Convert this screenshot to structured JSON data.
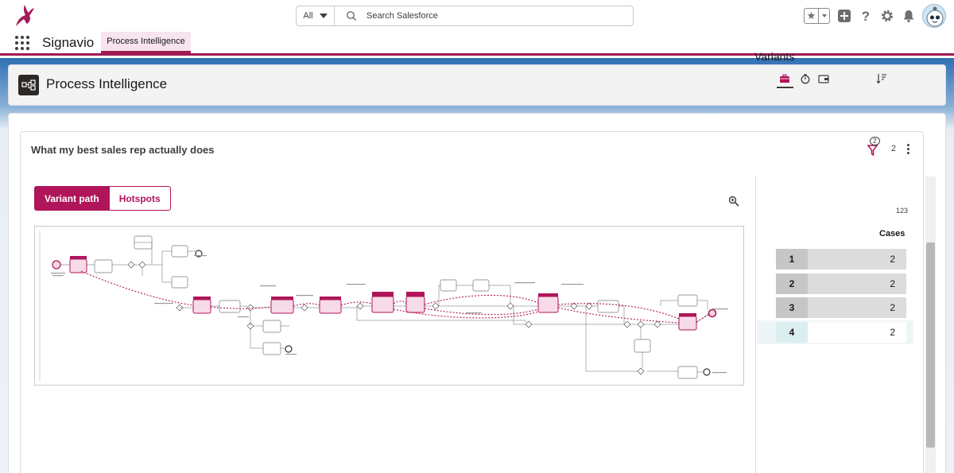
{
  "header": {
    "search": {
      "scope": "All",
      "placeholder": "Search Salesforce"
    },
    "icons": [
      "gazelle-logo-icon",
      "star-icon",
      "plus-icon",
      "help-icon",
      "gear-icon",
      "bell-icon",
      "avatar"
    ]
  },
  "nav": {
    "app_name": "Signavio",
    "tab": "Process Intelligence"
  },
  "page": {
    "title": "Process Intelligence"
  },
  "card": {
    "title": "What my best sales rep actually does",
    "filter_count": "2",
    "filter_number": "2",
    "tabs": {
      "variant_path": "Variant path",
      "hotspots": "Hotspots"
    }
  },
  "variants": {
    "title": "Variants",
    "number_label": "123",
    "cases_label": "Cases",
    "rows": [
      {
        "index": "1",
        "cases": "2"
      },
      {
        "index": "2",
        "cases": "2"
      },
      {
        "index": "3",
        "cases": "2"
      },
      {
        "index": "4",
        "cases": "2"
      }
    ]
  },
  "colors": {
    "brand": "#b0155a",
    "nav_accent": "#9e1a55",
    "selected_row": "#dbeef0"
  }
}
